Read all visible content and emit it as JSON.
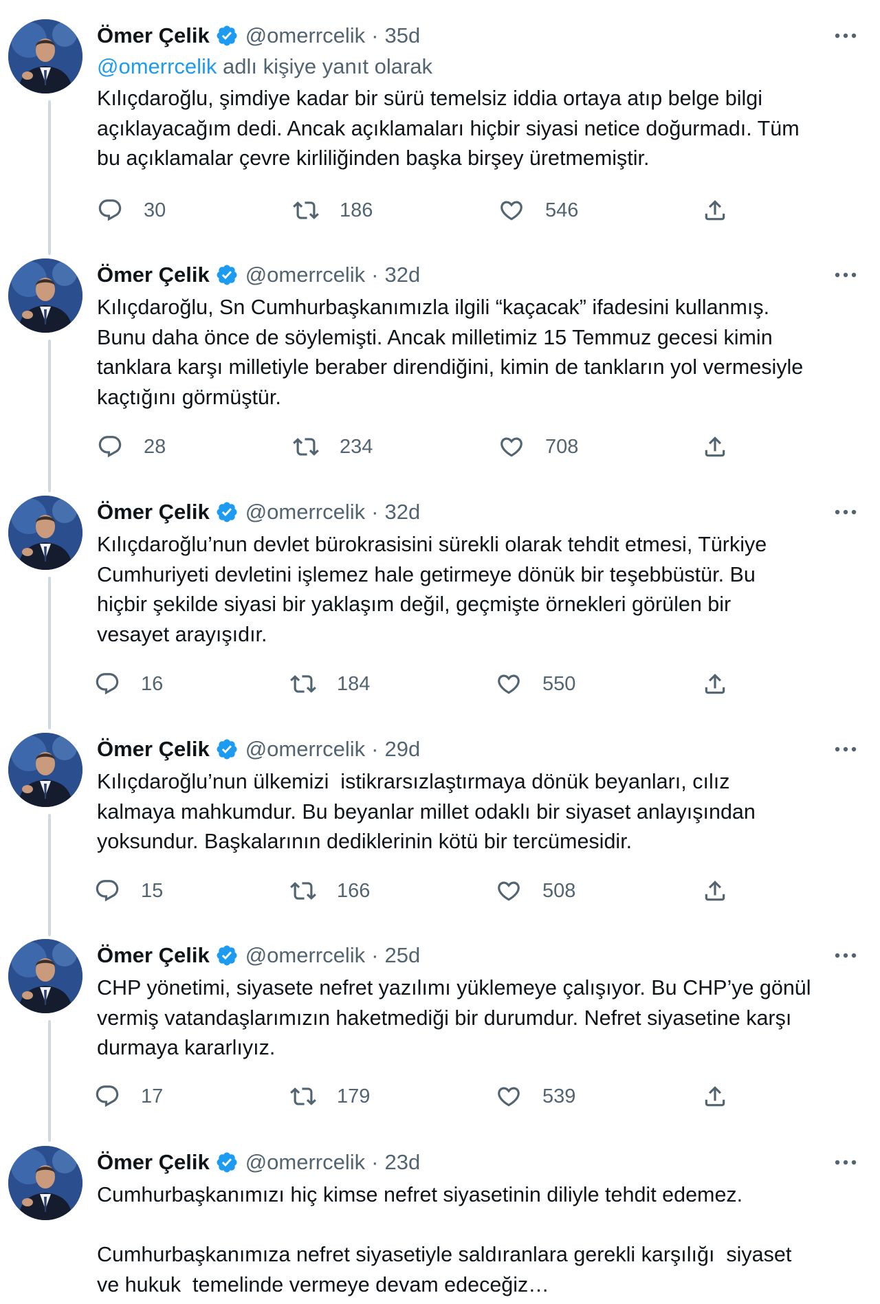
{
  "tweets": [
    {
      "name": "Ömer Çelik",
      "handle": "@omerrcelik",
      "separator": "·",
      "time": "35d",
      "reply_to": {
        "mention": "@omerrcelik",
        "suffix": " adlı kişiye yanıt olarak"
      },
      "text": "Kılıçdaroğlu, şimdiye kadar bir sürü temelsiz iddia ortaya atıp belge bilgi\naçıklayacağım dedi. Ancak açıklamaları hiçbir siyasi netice doğurmadı. Tüm\nbu açıklamalar çevre kirliliğinden başka birşey üretmemiştir.",
      "replies": "30",
      "retweets": "186",
      "likes": "546"
    },
    {
      "name": "Ömer Çelik",
      "handle": "@omerrcelik",
      "separator": "·",
      "time": "32d",
      "text": "Kılıçdaroğlu, Sn Cumhurbaşkanımızla ilgili “kaçacak” ifadesini kullanmış.\nBunu daha önce de söylemişti. Ancak milletimiz 15 Temmuz gecesi kimin\ntanklara karşı milletiyle beraber direndiğini, kimin de tankların yol vermesiyle\nkaçtığını görmüştür.",
      "replies": "28",
      "retweets": "234",
      "likes": "708"
    },
    {
      "name": "Ömer Çelik",
      "handle": "@omerrcelik",
      "separator": "·",
      "time": "32d",
      "text": "Kılıçdaroğlu’nun devlet bürokrasisini sürekli olarak tehdit etmesi, Türkiye\nCumhuriyeti devletini işlemez hale getirmeye dönük bir teşebbüstür. Bu\nhiçbir şekilde siyasi bir yaklaşım değil, geçmişte örnekleri görülen bir\nvesayet arayışıdır.",
      "replies": "16",
      "retweets": "184",
      "likes": "550"
    },
    {
      "name": "Ömer Çelik",
      "handle": "@omerrcelik",
      "separator": "·",
      "time": "29d",
      "text": "Kılıçdaroğlu’nun ülkemizi  istikrarsızlaştırmaya dönük beyanları, cılız\nkalmaya mahkumdur. Bu beyanlar millet odaklı bir siyaset anlayışından\nyoksundur. Başkalarının dediklerinin kötü bir tercümesidir.",
      "replies": "15",
      "retweets": "166",
      "likes": "508"
    },
    {
      "name": "Ömer Çelik",
      "handle": "@omerrcelik",
      "separator": "·",
      "time": "25d",
      "text": "CHP yönetimi, siyasete nefret yazılımı yüklemeye çalışıyor. Bu CHP’ye gönül\nvermiş vatandaşlarımızın haketmediği bir durumdur. Nefret siyasetine karşı\ndurmaya kararlıyız.",
      "replies": "17",
      "retweets": "179",
      "likes": "539"
    },
    {
      "name": "Ömer Çelik",
      "handle": "@omerrcelik",
      "separator": "·",
      "time": "23d",
      "text": "Cumhurbaşkanımızı hiç kimse nefret siyasetinin diliyle tehdit edemez.\n\nCumhurbaşkanımıza nefret siyasetiyle saldıranlara gerekli karşılığı  siyaset\nve hukuk  temelinde vermeye devam edeceğiz…"
    }
  ],
  "icons": {
    "reply": "reply-icon",
    "retweet": "retweet-icon",
    "like": "heart-icon",
    "share": "share-icon",
    "more": "more-icon",
    "verified": "verified-badge-icon"
  },
  "colors": {
    "text": "#0f1419",
    "secondary": "#536471",
    "accent": "#1d9bf0",
    "thread_line": "#cfd9de"
  }
}
